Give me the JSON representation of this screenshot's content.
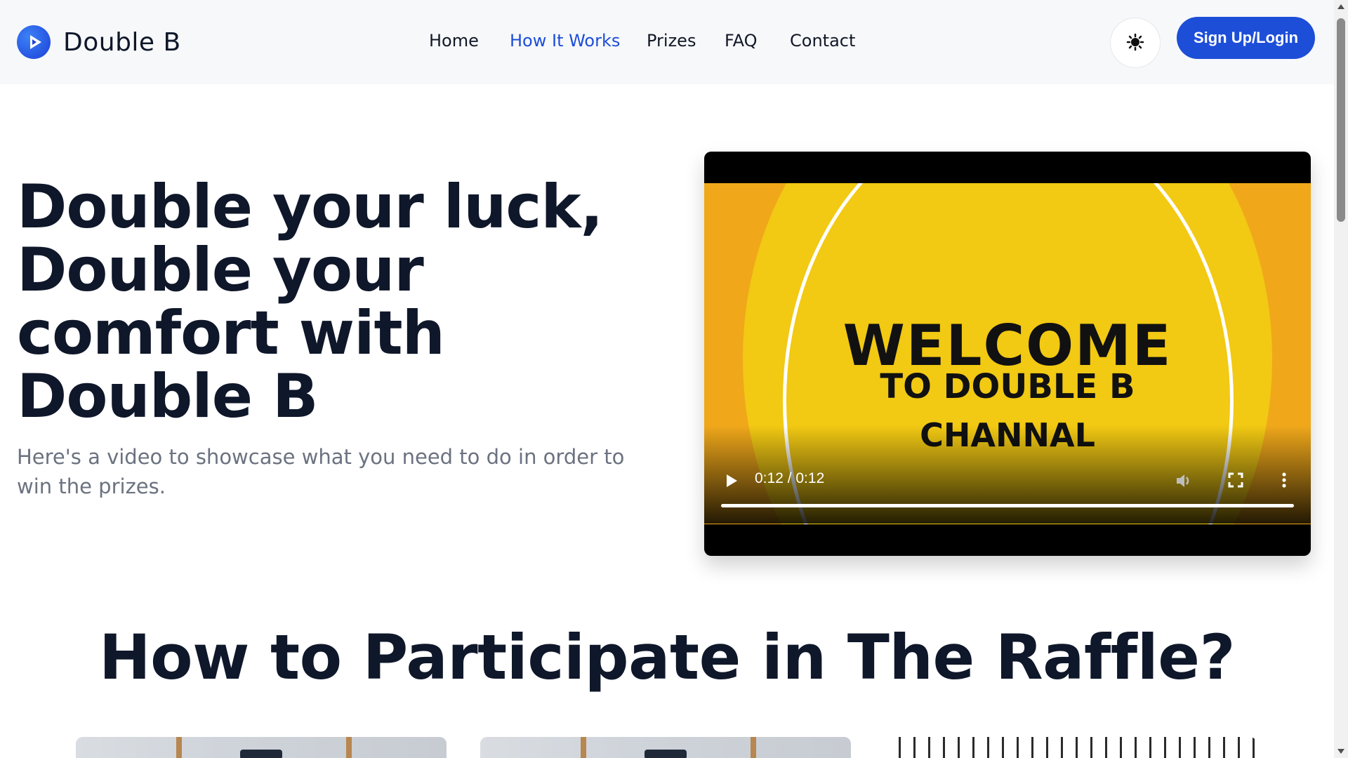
{
  "brand": {
    "name": "Double B",
    "logo_icon": "play-icon"
  },
  "nav": {
    "items": [
      {
        "label": "Home",
        "active": false
      },
      {
        "label": "How It Works",
        "active": true
      },
      {
        "label": "Prizes",
        "active": false
      },
      {
        "label": "FAQ",
        "active": false
      },
      {
        "label": "Contact",
        "active": false
      }
    ]
  },
  "header": {
    "theme_toggle_icon": "sun-icon",
    "signup_label": "Sign Up/Login"
  },
  "hero": {
    "title_lines": [
      "Double your luck,",
      "Double your",
      "comfort with",
      "Double B"
    ],
    "subtitle": "Here's a video to showcase what you need to do in order to win the prizes."
  },
  "video": {
    "frame_text": {
      "line1": "WELCOME",
      "line2": "TO DOUBLE B",
      "line3": "CHANNAL"
    },
    "time_display": "0:12 / 0:12",
    "progress": 1.0,
    "icons": [
      "play-icon",
      "volume-icon",
      "fullscreen-icon",
      "more-vertical-icon"
    ]
  },
  "section": {
    "title": "How to Participate in The Raffle?"
  },
  "colors": {
    "accent": "#1d4ed8",
    "heading": "#0f172a",
    "muted": "#6b7280",
    "header_bg": "#f7f8fa",
    "video_orange": "#f0a81a",
    "video_yellow": "#f2c913"
  }
}
